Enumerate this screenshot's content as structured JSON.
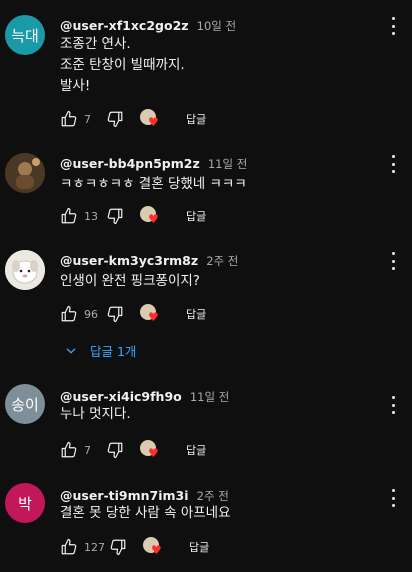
{
  "comments": [
    {
      "avatar_text": "늑대",
      "avatar_color": "#1a9aa8",
      "handle": "@user-xf1xc2go2z",
      "time": "10일 전",
      "text": "조종간 연사.\n조준 탄창이 빌때까지.\n발사!",
      "likes": "7",
      "reply_label": "답글"
    },
    {
      "avatar_text": "",
      "avatar_color": "#5a4630",
      "handle": "@user-bb4pn5pm2z",
      "time": "11일 전",
      "text": "ㅋㅎㅋㅎㅋㅎ 결혼 당했네 ㅋㅋㅋ",
      "likes": "13",
      "reply_label": "답글"
    },
    {
      "avatar_text": "",
      "avatar_color": "#e8e4df",
      "handle": "@user-km3yc3rm8z",
      "time": "2주 전",
      "text": "인생이 완전 핑크퐁이지?",
      "likes": "96",
      "reply_label": "답글"
    },
    {
      "avatar_text": "송이",
      "avatar_color": "#7e8f99",
      "handle": "@user-xi4ic9fh9o",
      "time": "11일 전",
      "text": "누나 멋지다.",
      "likes": "7",
      "reply_label": "답글"
    },
    {
      "avatar_text": "박",
      "avatar_color": "#c2185b",
      "handle": "@user-ti9mn7im3i",
      "time": "2주 전",
      "text": "결혼 못 당한 사람 속 아프네요",
      "likes": "127",
      "reply_label": "답글"
    }
  ],
  "replies_toggle": "답글 1개",
  "colors": {
    "background": "#0f0f0f",
    "link": "#3ea6ff",
    "heart": "#ff2e2e"
  }
}
